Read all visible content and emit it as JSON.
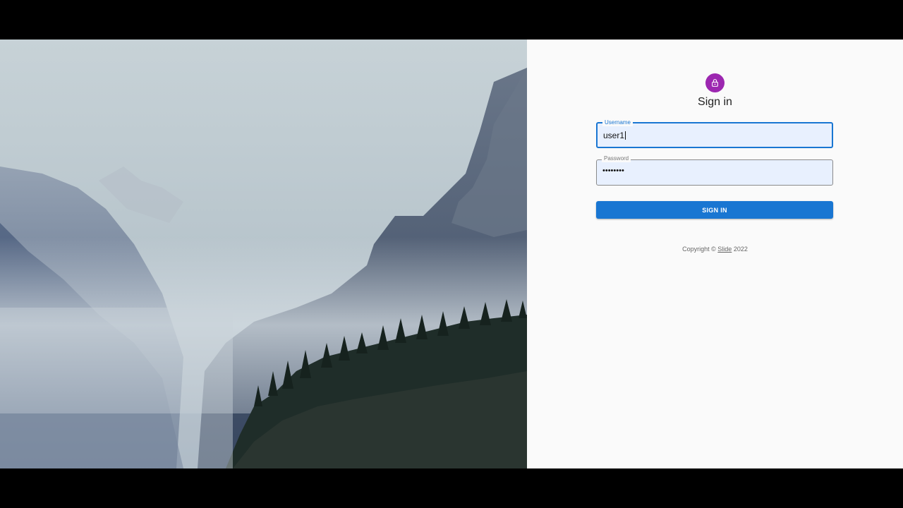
{
  "form": {
    "title": "Sign in",
    "username": {
      "label": "Username",
      "value": "user1"
    },
    "password": {
      "label": "Password",
      "value": "••••••••"
    },
    "submit_label": "SIGN IN"
  },
  "footer": {
    "prefix": "Copyright © ",
    "link_text": "Slide",
    "year": " 2022"
  },
  "colors": {
    "avatar": "#9c27b0",
    "primary": "#1976d2",
    "autofill": "#e8f0fe"
  },
  "icons": {
    "avatar_icon": "lock-icon"
  }
}
